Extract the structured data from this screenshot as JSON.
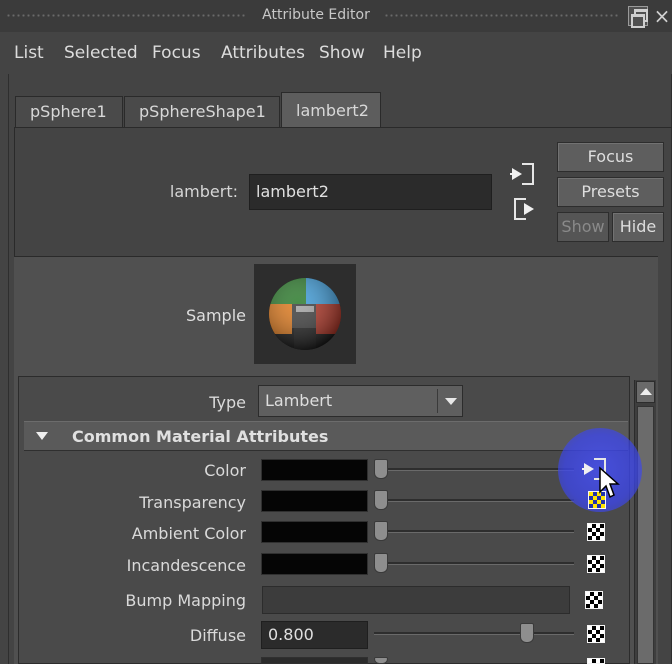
{
  "window": {
    "title": "Attribute Editor"
  },
  "menu": [
    "List",
    "Selected",
    "Focus",
    "Attributes",
    "Show",
    "Help"
  ],
  "tabs": [
    {
      "label": "pSphere1",
      "active": false
    },
    {
      "label": "pSphereShape1",
      "active": false
    },
    {
      "label": "lambert2",
      "active": true
    }
  ],
  "node": {
    "type_label": "lambert:",
    "name_value": "lambert2"
  },
  "side_buttons": {
    "focus": "Focus",
    "presets": "Presets",
    "show": "Show",
    "hide": "Hide"
  },
  "swatch": {
    "label": "Sample"
  },
  "material": {
    "type_label": "Type",
    "type_value": "Lambert"
  },
  "section": {
    "title": "Common Material Attributes"
  },
  "attributes": [
    {
      "label": "Color",
      "kind": "color",
      "color": "#050505",
      "slider_value": 0.0
    },
    {
      "label": "Transparency",
      "kind": "color",
      "color": "#050505",
      "slider_value": 0.0
    },
    {
      "label": "Ambient Color",
      "kind": "color",
      "color": "#050505",
      "slider_value": 0.0
    },
    {
      "label": "Incandescence",
      "kind": "color",
      "color": "#050505",
      "slider_value": 0.0
    },
    {
      "label": "Bump Mapping",
      "kind": "map"
    },
    {
      "label": "Diffuse",
      "kind": "number",
      "value": "0.800",
      "slider_value": 0.8
    }
  ],
  "colors": {
    "background": "#444444",
    "highlight": "#4450ff",
    "swatch_black": "#050505"
  }
}
